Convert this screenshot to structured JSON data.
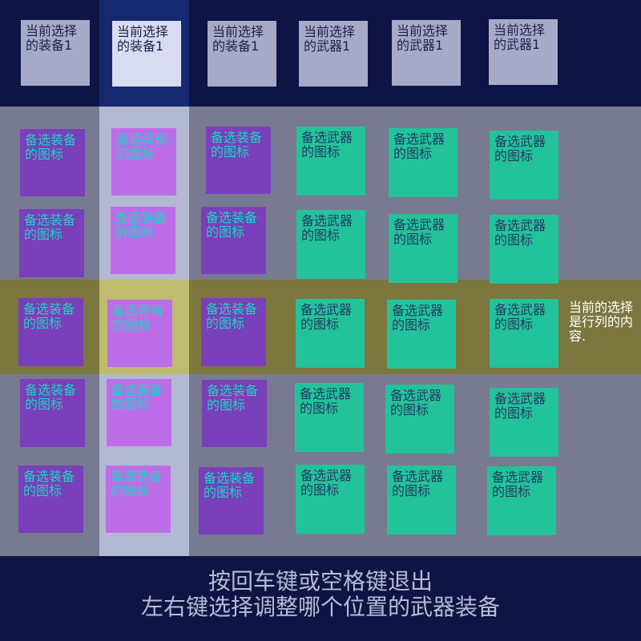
{
  "current_slots": [
    {
      "label": "当前选择的装备1",
      "type": "equipment",
      "active": false
    },
    {
      "label": "当前选择的装备1",
      "type": "equipment",
      "active": true
    },
    {
      "label": "当前选择的装备1",
      "type": "equipment",
      "active": false
    },
    {
      "label": "当前选择的武器1",
      "type": "weapon",
      "active": false
    },
    {
      "label": "当前选择的武器1",
      "type": "weapon",
      "active": false
    },
    {
      "label": "当前选择的武器1",
      "type": "weapon",
      "active": false
    }
  ],
  "candidate_grid": {
    "equipment_label": "备选装备的图标",
    "weapon_label": "备选武器的图标",
    "columns": 6,
    "rows": 5,
    "selected_column": 2,
    "selected_row": 3
  },
  "row_note": "当前的选择是行列的内容.",
  "footer": {
    "line1": "按回车键或空格键退出",
    "line2": "左右键选择调整哪个位置的武器装备"
  },
  "colors": {
    "background": "#0e1544",
    "grid": "#777a90",
    "column_highlight": "#16286f",
    "row_highlight": "#7b773f",
    "equipment_icon": "#7a3fba",
    "equipment_icon_selected": "#be6de9",
    "weapon_icon": "#22c39a",
    "equipment_text": "#1dd4c2",
    "weapon_text": "#263a63"
  }
}
